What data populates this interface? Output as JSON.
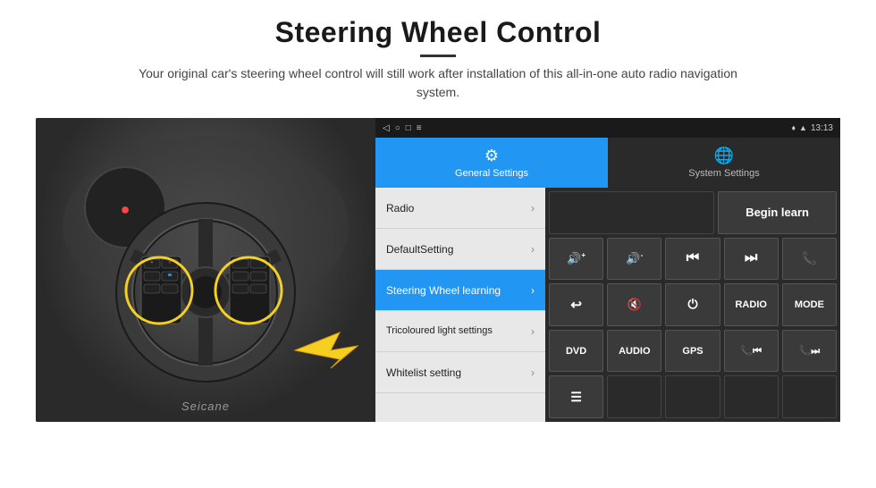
{
  "page": {
    "title": "Steering Wheel Control",
    "subtitle": "Your original car's steering wheel control will still work after installation of this all-in-one auto radio navigation system.",
    "divider_color": "#333"
  },
  "android": {
    "statusbar": {
      "time": "13:13",
      "nav_icons": [
        "◁",
        "○",
        "□",
        "≡"
      ]
    },
    "tabs": [
      {
        "label": "General Settings",
        "icon": "⚙",
        "active": true
      },
      {
        "label": "System Settings",
        "icon": "🌐",
        "active": false
      }
    ],
    "menu": [
      {
        "label": "Radio",
        "active": false
      },
      {
        "label": "DefaultSetting",
        "active": false
      },
      {
        "label": "Steering Wheel learning",
        "active": true
      },
      {
        "label": "Tricoloured light settings",
        "active": false
      },
      {
        "label": "Whitelist setting",
        "active": false
      }
    ],
    "grid_rows": [
      [
        {
          "type": "empty",
          "label": ""
        },
        {
          "type": "begin-learn",
          "label": "Begin learn"
        }
      ],
      [
        {
          "type": "btn",
          "label": "🔊+"
        },
        {
          "type": "btn",
          "label": "🔊-"
        },
        {
          "type": "btn",
          "label": "⏮"
        },
        {
          "type": "btn",
          "label": "⏭"
        },
        {
          "type": "btn",
          "label": "📞"
        }
      ],
      [
        {
          "type": "btn",
          "label": "↩"
        },
        {
          "type": "btn",
          "label": "🔇"
        },
        {
          "type": "btn",
          "label": "⏻"
        },
        {
          "type": "btn",
          "label": "RADIO"
        },
        {
          "type": "btn",
          "label": "MODE"
        }
      ],
      [
        {
          "type": "btn",
          "label": "DVD"
        },
        {
          "type": "btn",
          "label": "AUDIO"
        },
        {
          "type": "btn",
          "label": "GPS"
        },
        {
          "type": "btn",
          "label": "📞⏮"
        },
        {
          "type": "btn",
          "label": "📞⏭"
        }
      ],
      [
        {
          "type": "btn",
          "label": "≡"
        },
        {
          "type": "empty4",
          "label": ""
        },
        {
          "type": "empty4",
          "label": ""
        },
        {
          "type": "empty4",
          "label": ""
        },
        {
          "type": "empty4",
          "label": ""
        }
      ]
    ]
  },
  "watermark": "Seicane"
}
